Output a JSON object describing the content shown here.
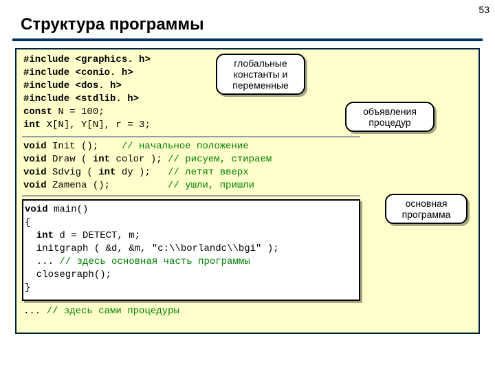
{
  "page_number": "53",
  "title": "Структура программы",
  "code": {
    "block1": {
      "l1a": "#include ",
      "l1b": "<graphics. h>",
      "l2a": "#include ",
      "l2b": "<conio. h>",
      "l3a": "#include ",
      "l3b": "<dos. h>",
      "l4a": "#include ",
      "l4b": "<stdlib. h>",
      "l5a": "const",
      "l5b": " N = 100;",
      "l6a": "int",
      "l6b": " X[N], Y[N], r = 3;"
    },
    "block2": {
      "l1a": "void",
      "l1b": " Init ();    ",
      "l1c": "// начальное положение",
      "l2a": "void",
      "l2b": " Draw ( ",
      "l2c": "int",
      "l2d": " color ); ",
      "l2e": "// рисуем, стираем",
      "l3a": "void",
      "l3b": " Sdvig ( ",
      "l3c": "int",
      "l3d": " dy );   ",
      "l3e": "// летят вверх",
      "l4a": "void",
      "l4b": " Zamena ();          ",
      "l4c": "// ушли, пришли"
    },
    "block3": {
      "l1a": "void",
      "l1b": " main()",
      "l2": "{",
      "l3a": "  int",
      "l3b": " d = DETECT, m;",
      "l4": "  initgraph ( &d, &m, \"с:\\\\borlandc\\\\bgi\" );",
      "l5a": "  ... ",
      "l5b": "// здесь основная часть программы",
      "l6": "  closegraph();",
      "l7": "}"
    },
    "tail_a": "... ",
    "tail_b": "// здесь сами процедуры"
  },
  "callouts": {
    "c1_l1": "глобальные",
    "c1_l2": "константы и",
    "c1_l3": "переменные",
    "c2_l1": "объявления",
    "c2_l2": "процедур",
    "c3_l1": "основная",
    "c3_l2": "программа"
  }
}
